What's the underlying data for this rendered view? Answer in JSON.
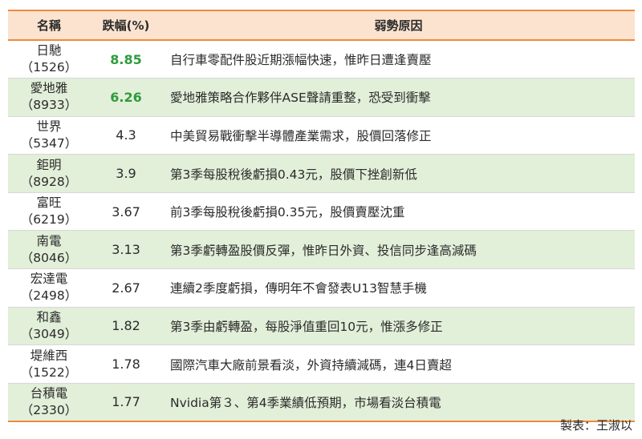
{
  "table": {
    "headers": {
      "name": "名稱",
      "pct": "跌幅(%)",
      "reason": "弱勢原因"
    },
    "rows": [
      {
        "name": "日馳",
        "code": "（1526）",
        "pct": "8.85",
        "highlight": true,
        "reason": "自行車零配件股近期漲幅快速，惟昨日遭逢賣壓"
      },
      {
        "name": "愛地雅",
        "code": "（8933）",
        "pct": "6.26",
        "highlight": true,
        "reason": "愛地雅策略合作夥伴ASE聲請重整，恐受到衝擊"
      },
      {
        "name": "世界",
        "code": "（5347）",
        "pct": "4.3",
        "highlight": false,
        "reason": "中美貿易戰衝擊半導體產業需求，股價回落修正"
      },
      {
        "name": "鉅明",
        "code": "（8928）",
        "pct": "3.9",
        "highlight": false,
        "reason": "第3季每股稅後虧損0.43元，股價下挫創新低"
      },
      {
        "name": "富旺",
        "code": "（6219）",
        "pct": "3.67",
        "highlight": false,
        "reason": "前3季每股稅後虧損0.35元，股價賣壓沈重"
      },
      {
        "name": "南電",
        "code": "（8046）",
        "pct": "3.13",
        "highlight": false,
        "reason": "第3季虧轉盈股價反彈，惟昨日外資、投信同步逢高減碼"
      },
      {
        "name": "宏達電",
        "code": "（2498）",
        "pct": "2.67",
        "highlight": false,
        "reason": "連續2季度虧損，傳明年不會發表U13智慧手機"
      },
      {
        "name": "和鑫",
        "code": "（3049）",
        "pct": "1.82",
        "highlight": false,
        "reason": "第3季由虧轉盈，每股淨值重回10元，惟漲多修正"
      },
      {
        "name": "堤維西",
        "code": "（1522）",
        "pct": "1.78",
        "highlight": false,
        "reason": "國際汽車大廠前景看淡，外資持續減碼，連4日賣超"
      },
      {
        "name": "台積電",
        "code": "（2330）",
        "pct": "1.77",
        "highlight": false,
        "reason": "Nvidia第３、第4季業績低預期，市場看淡台積電"
      }
    ]
  },
  "credit": "製表：王淑以",
  "colors": {
    "header_bg": "#fbe3cf",
    "header_border": "#f08a3c",
    "stripe_bg": "#e2efd9",
    "highlight_text": "#2e9b3c"
  }
}
